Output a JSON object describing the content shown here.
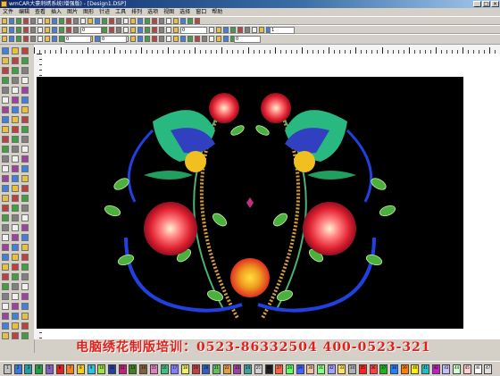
{
  "window": {
    "title": "wmCAR大豪刺绣系统(增强版) - [Design1.DSP]"
  },
  "menu": [
    "文件",
    "编辑",
    "查看",
    "插入",
    "图片",
    "图形",
    "针迹",
    "工具",
    "排列",
    "选项",
    "视图",
    "选择",
    "窗口",
    "帮助"
  ],
  "toolbar2": {
    "field1": "0",
    "field2": "0",
    "field3": "1"
  },
  "toolbar3": {
    "field1": "0",
    "field2": "0",
    "field3": "0"
  },
  "banner": {
    "text": "电脑绣花制版培训：0523-86332504  400-0523-321"
  },
  "palette": {
    "colors": [
      "#c0c0c0",
      "#3a7ad8",
      "#20a0a0",
      "#20a040",
      "#8060c0",
      "#e02020",
      "#f08020",
      "#f0d020",
      "#30c0e0",
      "#a0e040",
      "#2040a0",
      "#c02080",
      "#408020",
      "#806040",
      "#e080c0",
      "#40c080",
      "#8080ff",
      "#f0f060",
      "#c04040",
      "#3060c0",
      "#60c060",
      "#e0a040",
      "#a040a0",
      "#40a0a0",
      "#d0d0d0",
      "#202020",
      "#ff6040",
      "#60ff60",
      "#4060ff",
      "#f0c0a0",
      "#80ff80",
      "#a0a0ff",
      "#ffe060",
      "#b0b0b0",
      "#ff2020",
      "#ff4040",
      "#20b020",
      "#2080ff",
      "#ff8000",
      "#fff000",
      "#20c0c0",
      "#c020c0",
      "#c0c0ff",
      "#d0ffd0",
      "#ffd0d0",
      "#ffffff",
      "#e0e0e0"
    ],
    "labels": [
      "1",
      "2",
      "3",
      "4",
      "5",
      "6",
      "7",
      "8",
      "9",
      "10",
      "11",
      "12",
      "13",
      "14",
      "15",
      "16",
      "17",
      "18",
      "19",
      "20",
      "21",
      "22",
      "23",
      "24",
      "25",
      "26",
      "27",
      "28",
      "29",
      "30",
      "31",
      "32",
      "33",
      "34",
      "35",
      "36",
      "37",
      "38",
      "39",
      "40",
      "41",
      "42",
      "43",
      "44",
      "45",
      "46",
      "47"
    ]
  }
}
